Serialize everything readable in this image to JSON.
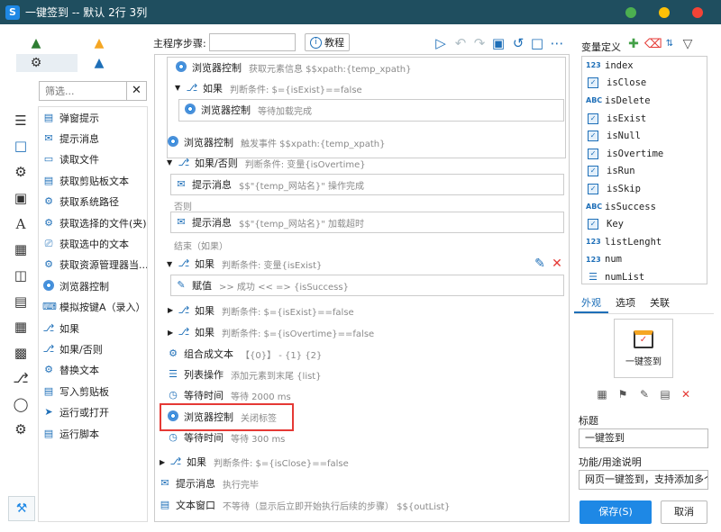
{
  "window": {
    "title": "一键签到 -- 默认 2行 3列"
  },
  "filter": {
    "placeholder": "筛选..."
  },
  "commands": [
    "弹窗提示",
    "提示消息",
    "读取文件",
    "获取剪贴板文本",
    "获取系统路径",
    "获取选择的文件(夹)",
    "获取选中的文本",
    "获取资源管理器当...",
    "浏览器控制",
    "模拟按键A（录入）",
    "如果",
    "如果/否则",
    "替换文本",
    "写入剪贴板",
    "运行或打开",
    "运行脚本"
  ],
  "toolbar": {
    "step_label": "主程序步骤:",
    "tutorial_label": "教程"
  },
  "flow": {
    "s1_name": "浏览器控制",
    "s1_desc": "获取元素信息 $$xpath:{temp_xpath}",
    "s2_name": "如果",
    "s2_desc": "判断条件: $={isExist}==false",
    "s3_name": "浏览器控制",
    "s3_desc": "等待加载完成",
    "s4_name": "浏览器控制",
    "s4_desc": "触发事件 $$xpath:{temp_xpath}",
    "s5_name": "如果/否则",
    "s5_desc": "判断条件: 变量{isOvertime}",
    "s6_name": "提示消息",
    "s6_desc": "$$\"{temp_网站名}\" 操作完成",
    "else_label": "否则",
    "s7_name": "提示消息",
    "s7_desc": "$$\"{temp_网站名}\" 加载超时",
    "end_label": "结束（如果）",
    "s8_name": "如果",
    "s8_desc": "判断条件: 变量{isExist}",
    "s9_name": "赋值",
    "s9_desc": ">> 成功 << => {isSuccess}",
    "s10_name": "如果",
    "s10_desc": "判断条件: $={isExist}==false",
    "s11_name": "如果",
    "s11_desc": "判断条件: $={isOvertime}==false",
    "s12_name": "组合成文本",
    "s12_desc": "【{0}】 - {1}  {2}",
    "s13_name": "列表操作",
    "s13_desc": "添加元素到末尾 {list}",
    "s14_name": "等待时间",
    "s14_desc": "等待 2000 ms",
    "s15_name": "浏览器控制",
    "s15_desc": "关闭标签",
    "s16_name": "等待时间",
    "s16_desc": "等待 300 ms",
    "s17_name": "如果",
    "s17_desc": "判断条件: $={isClose}==false",
    "s18_name": "提示消息",
    "s18_desc": "执行完毕",
    "s19_name": "文本窗口",
    "s19_desc": "不等待（显示后立即开始执行后续的步骤） $${outList}"
  },
  "variables": {
    "header": "变量定义",
    "items": [
      {
        "type": "123",
        "name": "index"
      },
      {
        "type": "check",
        "name": "isClose"
      },
      {
        "type": "ABC",
        "name": "isDelete"
      },
      {
        "type": "check",
        "name": "isExist"
      },
      {
        "type": "check",
        "name": "isNull"
      },
      {
        "type": "check",
        "name": "isOvertime"
      },
      {
        "type": "check",
        "name": "isRun"
      },
      {
        "type": "check",
        "name": "isSkip"
      },
      {
        "type": "ABC",
        "name": "isSuccess"
      },
      {
        "type": "check",
        "name": "Key"
      },
      {
        "type": "123",
        "name": "listLenght"
      },
      {
        "type": "123",
        "name": "num"
      },
      {
        "type": "list",
        "name": "numList"
      }
    ]
  },
  "props": {
    "tabs": [
      "外观",
      "选项",
      "关联"
    ],
    "icon_caption": "一键签到",
    "title_label": "标题",
    "title_value": "一键签到",
    "desc_label": "功能/用途说明",
    "desc_value": "网页一键签到，支持添加多个",
    "save_label": "保存(S)",
    "cancel_label": "取消"
  }
}
